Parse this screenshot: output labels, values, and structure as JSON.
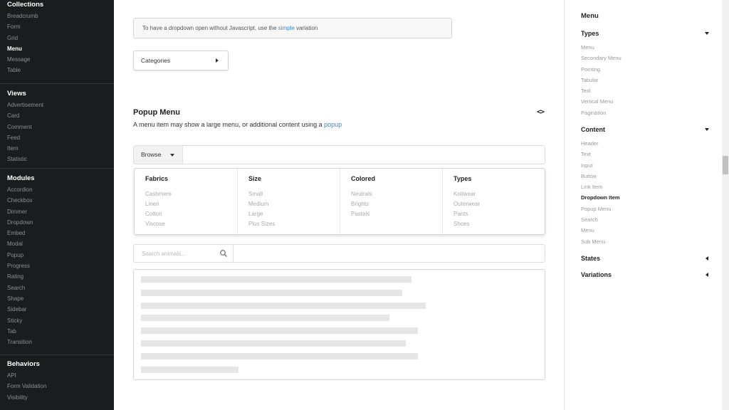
{
  "left_nav": {
    "collections": {
      "title": "Collections",
      "items": [
        "Breadcrumb",
        "Form",
        "Grid",
        "Menu",
        "Message",
        "Table"
      ]
    },
    "views": {
      "title": "Views",
      "items": [
        "Advertisement",
        "Card",
        "Comment",
        "Feed",
        "Item",
        "Statistic"
      ]
    },
    "modules": {
      "title": "Modules",
      "items": [
        "Accordion",
        "Checkbox",
        "Dimmer",
        "Dropdown",
        "Embed",
        "Modal",
        "Popup",
        "Progress",
        "Rating",
        "Search",
        "Shape",
        "Sidebar",
        "Sticky",
        "Tab",
        "Transition"
      ]
    },
    "behaviors": {
      "title": "Behaviors",
      "items": [
        "API",
        "Form Validation",
        "Visibility"
      ]
    }
  },
  "main": {
    "info_message": {
      "prefix": "To have a dropdown open without Javascript, use the ",
      "link": "simple",
      "suffix": " variation"
    },
    "categories_button": "Categories",
    "popup_section": {
      "title": "Popup Menu",
      "code_icon": "<>",
      "desc_prefix": "A menu item may show a large menu, or additional content using a ",
      "desc_link": "popup"
    },
    "browse_label": "Browse",
    "popup_columns": [
      {
        "title": "Fabrics",
        "items": [
          "Cashmere",
          "Linen",
          "Cotton",
          "Viscose"
        ]
      },
      {
        "title": "Size",
        "items": [
          "Small",
          "Medium",
          "Large",
          "Plus Sizes"
        ]
      },
      {
        "title": "Colored",
        "items": [
          "Neutrals",
          "Brights",
          "Pastels"
        ]
      },
      {
        "title": "Types",
        "items": [
          "Knitwear",
          "Outerwear",
          "Pants",
          "Shoes"
        ]
      }
    ],
    "search_placeholder": "Search animals..."
  },
  "toc": {
    "title": "Menu",
    "types": {
      "title": "Types",
      "items": [
        "Menu",
        "Secondary Menu",
        "Pointing",
        "Tabular",
        "Text",
        "Vertical Menu",
        "Pagination"
      ]
    },
    "content": {
      "title": "Content",
      "items": [
        "Header",
        "Text",
        "Input",
        "Button",
        "Link Item",
        "Dropdown Item",
        "Popup Menu",
        "Search",
        "Menu",
        "Sub Menu"
      ]
    },
    "states": {
      "title": "States"
    },
    "variations": {
      "title": "Variations"
    }
  },
  "colors": {
    "sidebar_bg": "#1b1c1d",
    "link": "#4183c4",
    "placeholder_line": "#e6e6e6"
  },
  "icons": {
    "search": "search-icon",
    "code": "code-icon"
  }
}
